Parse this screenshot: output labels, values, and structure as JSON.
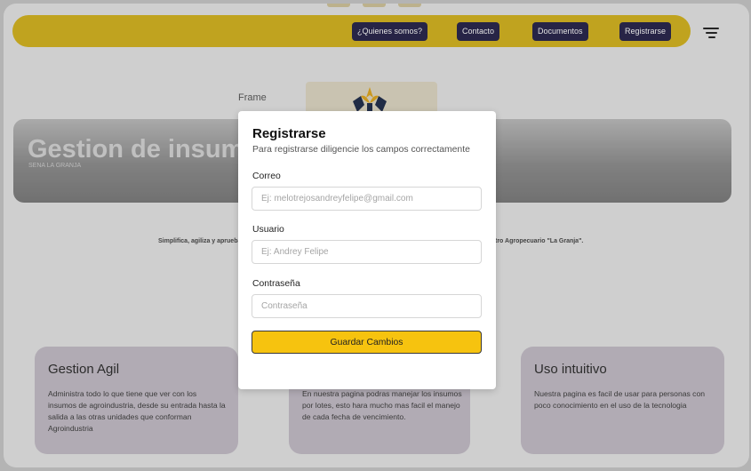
{
  "navbar": {
    "items": [
      "¿Quienes somos?",
      "Contacto",
      "Documentos",
      "Registrarse"
    ]
  },
  "frame_label": "Frame",
  "hero": {
    "title": "Gestion de insumos",
    "subtitle": "SENA LA GRANJA"
  },
  "description": {
    "left": "Simplifica, agiliza y aprueba",
    "right": "tro Agropecuario \"La Granja\"."
  },
  "cards": [
    {
      "title": "Gestion Agil",
      "text": "Administra todo lo que tiene que ver con los insumos de agroindustria, desde su entrada hasta la salida a las otras unidades que conforman Agroindustria"
    },
    {
      "title": "",
      "text": "En nuestra pagina podras manejar los insumos por lotes, esto hara mucho mas facil el manejo de cada fecha de vencimiento."
    },
    {
      "title": "Uso intuitivo",
      "text": "Nuestra pagina es facil de usar para personas con poco conocimiento en el uso de la tecnologia"
    }
  ],
  "modal": {
    "title": "Registrarse",
    "subtitle": "Para registrarse diligencie los campos correctamente",
    "fields": [
      {
        "label": "Correo",
        "placeholder": "Ej: melotrejosandreyfelipe@gmail.com",
        "value": ""
      },
      {
        "label": "Usuario",
        "placeholder": "Ej: Andrey Felipe",
        "value": ""
      },
      {
        "label": "Contraseña",
        "placeholder": "Contraseña",
        "value": ""
      }
    ],
    "submit_label": "Guardar Cambios"
  },
  "icons": {
    "menu": "hamburger-menu-icon",
    "logo": "sena-logo"
  },
  "colors": {
    "navbar": "#d7b61a",
    "nav_button": "#242048",
    "card": "#c6bfc9",
    "submit": "#f6c30f"
  }
}
